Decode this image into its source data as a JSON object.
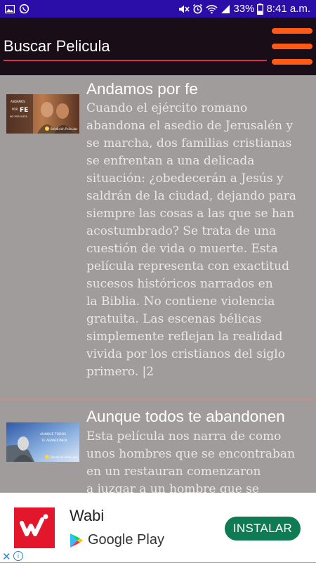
{
  "status_bar": {
    "battery_percent": "33%",
    "time": "8:41 a.m.",
    "left_icons": [
      "image-icon",
      "whatsapp-icon"
    ],
    "right_icons": [
      "mute-icon",
      "alarm-icon",
      "wifi-icon",
      "signal-icon",
      "battery-icon"
    ]
  },
  "app_bar": {
    "search_placeholder": "Buscar Pelicula",
    "menu_icon": "hamburger-menu-icon",
    "accent_color": "#ff5a16"
  },
  "movies": [
    {
      "title": "Andamos por fe",
      "thumbnail_caption": "ANDAMOS POR FE NO POR VISTA",
      "thumbnail_brand": "Bendición Películas",
      "description_lines": [
        "Cuando el ejército romano",
        "abandona el asedio de Jerusalén y",
        "se marcha, dos familias cristianas",
        "se enfrentan a una delicada",
        "situación: ¿obedecerán a Jesús y",
        "saldrán de la ciudad, dejando para",
        "siempre las cosas a las que se han",
        "acostumbrado? Se trata de una",
        "cuestión de vida o muerte. Esta",
        "película representa con exactitud",
        "sucesos históricos narrados en",
        "la Biblia. No contiene violencia",
        "gratuita. Las escenas bélicas",
        "simplemente reflejan la realidad",
        "vivida por los cristianos del siglo",
        "primero. |2"
      ]
    },
    {
      "title": "Aunque todos te abandonen",
      "thumbnail_caption": "AUNQUE TODOS TE ABANDONEN",
      "thumbnail_brand": "Bendición Películas",
      "description_lines": [
        "Esta película nos narra de como",
        "unos hombres que se encontraban",
        "en un restauran comenzaron",
        "a juzgar a un hombre que se"
      ]
    }
  ],
  "ad": {
    "app_name": "Wabi",
    "store_name": "Google Play",
    "install_label": "INSTALAR",
    "close_symbol": "✕",
    "info_symbol": "i",
    "button_color": "#0f7b53",
    "icon_color": "#e3172b"
  }
}
